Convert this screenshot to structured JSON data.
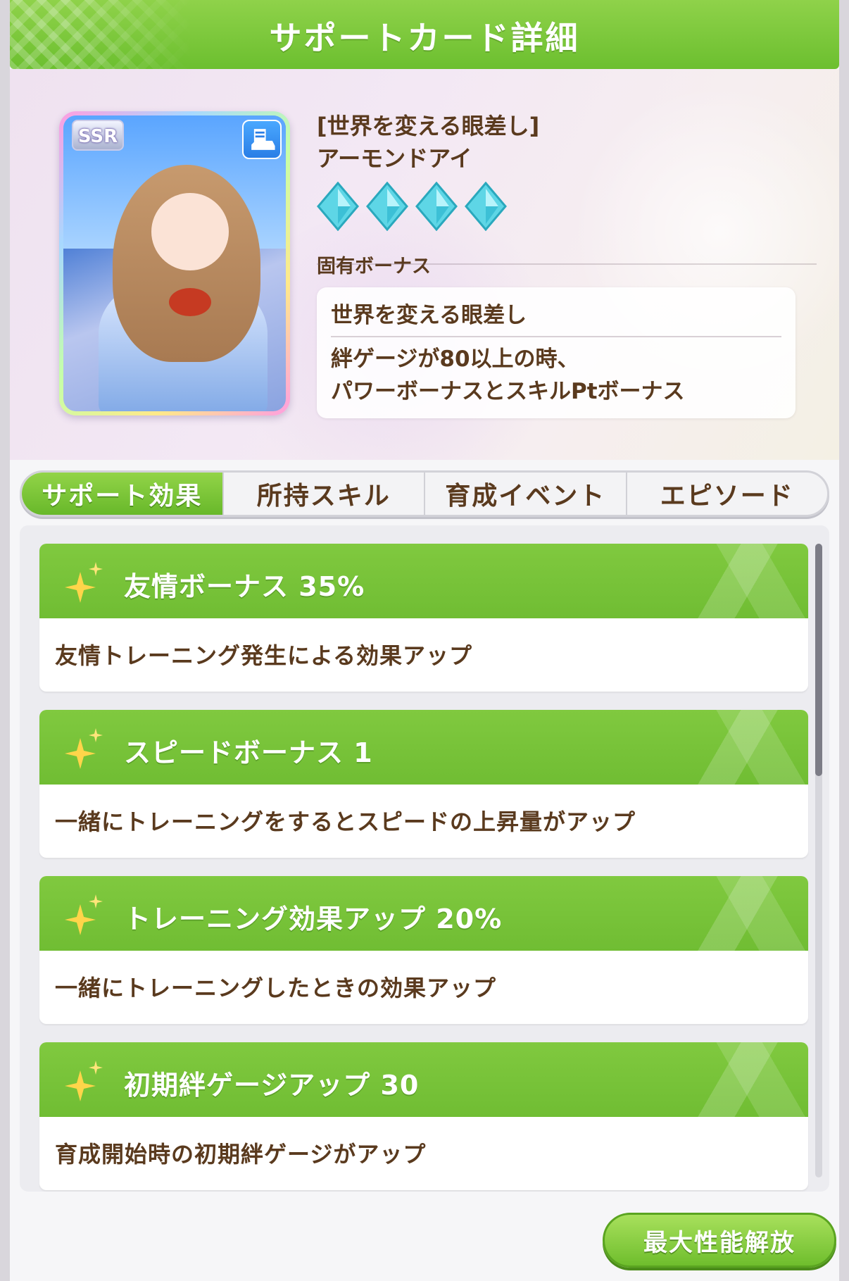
{
  "header": {
    "title": "サポートカード詳細"
  },
  "card": {
    "rarity": "SSR",
    "type_icon": "power-shoe-icon",
    "title": "[世界を変える眼差し]",
    "name": "アーモンドアイ",
    "star_count": 4,
    "bonus_label": "固有ボーナス",
    "bonus_name": "世界を変える眼差し",
    "bonus_desc_line1": "絆ゲージが80以上の時、",
    "bonus_desc_line2": "パワーボーナスとスキルPtボーナス"
  },
  "tabs": [
    {
      "label": "サポート効果",
      "active": true
    },
    {
      "label": "所持スキル",
      "active": false
    },
    {
      "label": "育成イベント",
      "active": false
    },
    {
      "label": "エピソード",
      "active": false
    }
  ],
  "effects": [
    {
      "title": "友情ボーナス 35%",
      "desc": "友情トレーニング発生による効果アップ"
    },
    {
      "title": "スピードボーナス 1",
      "desc": "一緒にトレーニングをするとスピードの上昇量がアップ"
    },
    {
      "title": "トレーニング効果アップ 20%",
      "desc": "一緒にトレーニングしたときの効果アップ"
    },
    {
      "title": "初期絆ゲージアップ 30",
      "desc": "育成開始時の初期絆ゲージがアップ"
    }
  ],
  "buttons": {
    "max_unlock": "最大性能解放"
  },
  "colors": {
    "accent_green": "#70bd33",
    "text_brown": "#5a3a1e"
  }
}
